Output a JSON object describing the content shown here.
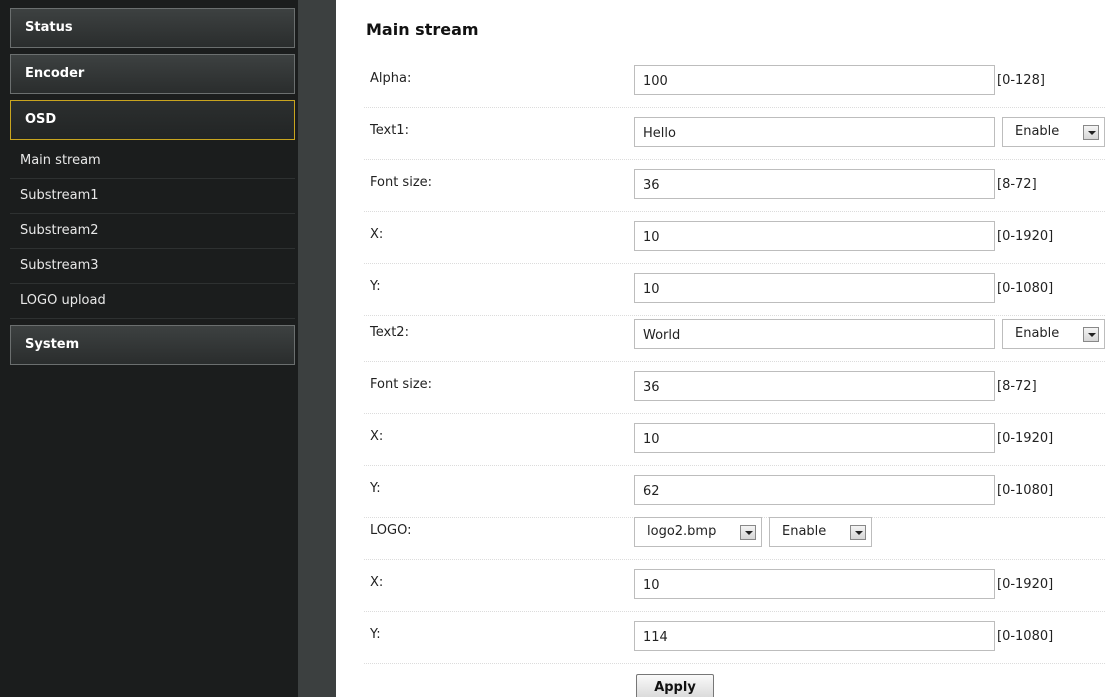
{
  "sidebar": {
    "status_label": "Status",
    "encoder_label": "Encoder",
    "osd_label": "OSD",
    "osd_items": [
      "Main stream",
      "Substream1",
      "Substream2",
      "Substream3",
      "LOGO upload"
    ],
    "system_label": "System"
  },
  "main": {
    "title": "Main stream",
    "alpha": {
      "label": "Alpha:",
      "value": "100",
      "range": "[0-128]"
    },
    "text1": {
      "label": "Text1:",
      "value": "Hello",
      "enable": "Enable"
    },
    "font_size_1": {
      "label": "Font size:",
      "value": "36",
      "range": "[8-72]"
    },
    "x1": {
      "label": "X:",
      "value": "10",
      "range": "[0-1920]"
    },
    "y1": {
      "label": "Y:",
      "value": "10",
      "range": "[0-1080]"
    },
    "text2": {
      "label": "Text2:",
      "value": "World",
      "enable": "Enable"
    },
    "font_size_2": {
      "label": "Font size:",
      "value": "36",
      "range": "[8-72]"
    },
    "x2": {
      "label": "X:",
      "value": "10",
      "range": "[0-1920]"
    },
    "y2": {
      "label": "Y:",
      "value": "62",
      "range": "[0-1080]"
    },
    "logo": {
      "label": "LOGO:",
      "file": "logo2.bmp",
      "enable": "Enable"
    },
    "x3": {
      "label": "X:",
      "value": "10",
      "range": "[0-1920]"
    },
    "y3": {
      "label": "Y:",
      "value": "114",
      "range": "[0-1080]"
    },
    "apply_label": "Apply"
  },
  "colors": {
    "sidebar_bg": "#1b1d1d",
    "gutter_bg": "#3c4040",
    "active_border": "#c9a51f"
  }
}
